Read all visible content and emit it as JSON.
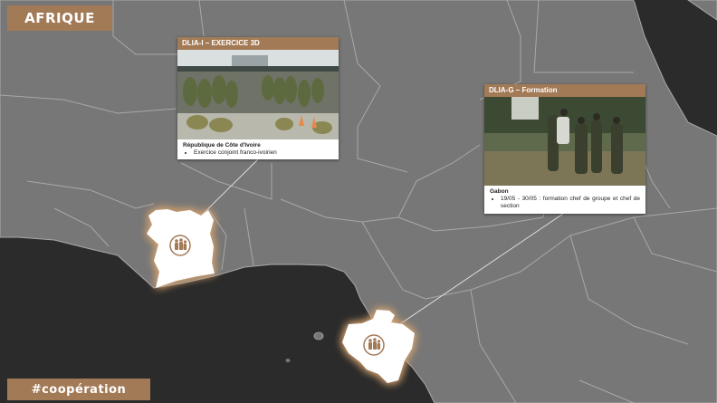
{
  "header": {
    "region_label": "AFRIQUE"
  },
  "footer": {
    "hashtag": "#coopération"
  },
  "colors": {
    "accent": "#a37a56",
    "ocean": "#2b2b2b",
    "land": "#777777",
    "border": "#a8a8a8",
    "highlight": "#ffffff",
    "glow": "#d7a36e"
  },
  "missions": [
    {
      "title": "DLIA-I – EXERCICE 3D",
      "country": "République de Côte d'Ivoire",
      "details": [
        "Exercice conjoint franco-ivoirien"
      ],
      "photo_icon": "soldiers-with-parachutes-photo"
    },
    {
      "title": "DLIA-G – Formation",
      "country": "Gabon",
      "details": [
        "19/05 - 30/05 : formation chef de groupe et chef de section"
      ],
      "photo_icon": "soldiers-training-photo"
    }
  ],
  "highlighted_countries": [
    {
      "name": "Côte d'Ivoire",
      "icon": "soldiers-group-icon"
    },
    {
      "name": "Gabon",
      "icon": "soldiers-group-icon"
    }
  ]
}
